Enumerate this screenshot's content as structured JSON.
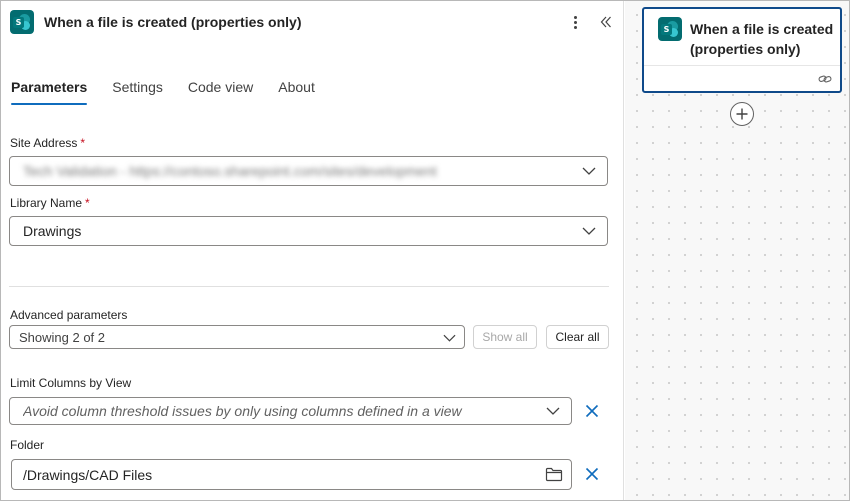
{
  "panel": {
    "title": "When a file is created (properties only)",
    "tabs": [
      {
        "label": "Parameters",
        "active": true
      },
      {
        "label": "Settings",
        "active": false
      },
      {
        "label": "Code view",
        "active": false
      },
      {
        "label": "About",
        "active": false
      }
    ],
    "site_address": {
      "label": "Site Address",
      "required_mark": "*",
      "value": "Tech Validation - https://contoso.sharepoint.com/sites/development"
    },
    "library_name": {
      "label": "Library Name",
      "required_mark": "*",
      "value": "Drawings"
    },
    "advanced": {
      "label": "Advanced parameters",
      "value": "Showing 2 of 2",
      "show_all_label": "Show all",
      "clear_all_label": "Clear all"
    },
    "limit_columns": {
      "label": "Limit Columns by View",
      "placeholder": "Avoid column threshold issues by only using columns defined in a view"
    },
    "folder": {
      "label": "Folder",
      "value": "/Drawings/CAD Files"
    }
  },
  "canvas": {
    "card_title": "When a file is created (properties only)"
  },
  "icons": {
    "sharepoint": "sharepoint-icon",
    "more": "more-vertical-icon",
    "collapse": "double-chevron-left-icon",
    "chevron": "chevron-down-icon",
    "remove": "close-icon",
    "folder": "folder-icon",
    "link": "link-icon",
    "add": "plus-circle-icon"
  },
  "colors": {
    "accent": "#0f6cbd",
    "card_border": "#0f4a8a",
    "required": "#c50f1f",
    "sharepoint": "#036c70"
  }
}
